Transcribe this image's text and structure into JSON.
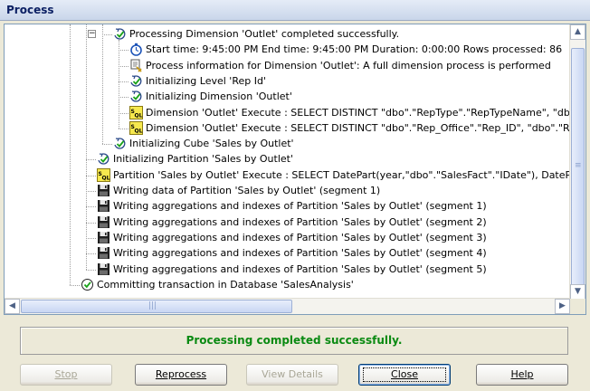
{
  "window": {
    "title": "Process"
  },
  "tree": {
    "rows": [
      {
        "text": "Processing Dimension 'Outlet' completed successfully.",
        "icon": "processing-check-icon",
        "indent": 0,
        "expander": "−"
      },
      {
        "text": "Start time: 9:45:00 PM  End time: 9:45:00 PM  Duration: 0:00:00  Rows processed: 86",
        "icon": "stopwatch-icon",
        "indent": 1
      },
      {
        "text": "Process information for Dimension 'Outlet': A full dimension process is performed",
        "icon": "process-info-icon",
        "indent": 1
      },
      {
        "text": "Initializing Level 'Rep Id'",
        "icon": "initialize-check-icon",
        "indent": 1
      },
      {
        "text": "Initializing Dimension 'Outlet'",
        "icon": "initialize-check-icon",
        "indent": 1
      },
      {
        "text": "Dimension 'Outlet' Execute : SELECT DISTINCT \"dbo\".\"RepType\".\"RepTypeName\", \"dbo\".\"Rep",
        "icon": "sql-icon",
        "indent": 1
      },
      {
        "text": "Dimension 'Outlet' Execute : SELECT DISTINCT \"dbo\".\"Rep_Office\".\"Rep_ID\", \"dbo\".\"Rep_Off",
        "icon": "sql-icon",
        "indent": 1
      },
      {
        "text": "Initializing Cube 'Sales by Outlet'",
        "icon": "initialize-check-icon",
        "indent": 0
      },
      {
        "text": "Initializing Partition 'Sales by Outlet'",
        "icon": "initialize-check-icon",
        "indent": -1
      },
      {
        "text": "Partition 'Sales by Outlet' Execute : SELECT DatePart(year,\"dbo\".\"SalesFact\".\"IDate\"), DatePart(quar",
        "icon": "sql-icon",
        "indent": -1
      },
      {
        "text": "Writing data of Partition 'Sales by Outlet' (segment  1)",
        "icon": "floppy-disk-icon",
        "indent": -1
      },
      {
        "text": "Writing aggregations and indexes of Partition 'Sales by Outlet' (segment  1)",
        "icon": "floppy-disk-icon",
        "indent": -1
      },
      {
        "text": "Writing aggregations and indexes of Partition 'Sales by Outlet' (segment  2)",
        "icon": "floppy-disk-icon",
        "indent": -1
      },
      {
        "text": "Writing aggregations and indexes of Partition 'Sales by Outlet' (segment  3)",
        "icon": "floppy-disk-icon",
        "indent": -1
      },
      {
        "text": "Writing aggregations and indexes of Partition 'Sales by Outlet' (segment  4)",
        "icon": "floppy-disk-icon",
        "indent": -1
      },
      {
        "text": "Writing aggregations and indexes of Partition 'Sales by Outlet' (segment  5)",
        "icon": "floppy-disk-icon",
        "indent": -1
      },
      {
        "text": "Committing transaction in Database 'SalesAnalysis'",
        "icon": "check-circle-icon",
        "indent": -2
      }
    ],
    "hscroll_grip": "|||",
    "vscroll_grip": "≡"
  },
  "status": {
    "message": "Processing completed successfully.",
    "color": "#0a8a12"
  },
  "buttons": {
    "stop": {
      "label": "Stop",
      "enabled": false
    },
    "reprocess": {
      "label": "Reprocess",
      "enabled": true
    },
    "view_details": {
      "label": "View Details",
      "enabled": false
    },
    "close": {
      "label": "Close",
      "enabled": true,
      "default": true
    },
    "help": {
      "label": "Help",
      "enabled": true
    }
  }
}
